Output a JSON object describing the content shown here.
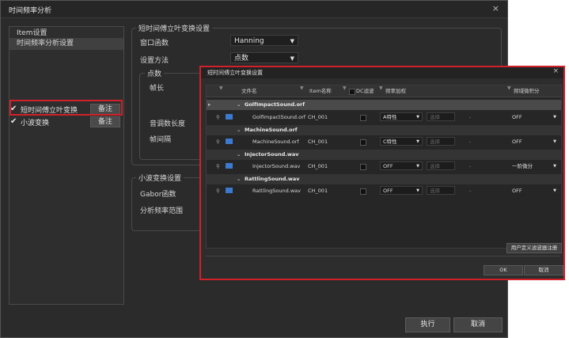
{
  "window": {
    "title": "时间频率分析",
    "close": "×"
  },
  "left": {
    "items": [
      {
        "label": "Item设置"
      },
      {
        "label": "时间频率分析设置"
      }
    ],
    "checks": [
      {
        "label": "短时间傅立叶变换",
        "note": "备注",
        "checked": true
      },
      {
        "label": "小波变换",
        "note": "备注",
        "checked": true
      }
    ]
  },
  "stft": {
    "title": "短时间傅立叶变换设置",
    "window_label": "窗口函数",
    "window_value": "Hanning",
    "method_label": "设置方法",
    "method_value": "点数",
    "points_group": "点数",
    "frame_length": "帧长",
    "fft_length": "音调数长度",
    "frame_interval": "帧间隔"
  },
  "wavelet": {
    "title": "小波变换设置",
    "gabor": "Gabor函数",
    "range": "分析频率范围"
  },
  "buttons": {
    "run": "执行",
    "cancel": "取消"
  },
  "dialog": {
    "title": "短时间傅立叶变换设置",
    "close": "×",
    "headers": [
      "文件名",
      "Item名称",
      "DC滤波",
      "频率加权",
      "频域微积分"
    ],
    "files": [
      {
        "group": "GolfImpactSound.orf",
        "file": "GolfImpactSound.orf",
        "ch": "CH_001",
        "weight": "A特性",
        "extra": "选择",
        "dash": "-",
        "integral": "OFF"
      },
      {
        "group": "MachineSound.orf",
        "file": "MachineSound.orf",
        "ch": "CH_001",
        "weight": "C特性",
        "extra": "选择",
        "dash": "-",
        "integral": "OFF"
      },
      {
        "group": "InjectorSound.wav",
        "file": "InjectorSound.wav",
        "ch": "CH_001",
        "weight": "OFF",
        "extra": "选择",
        "dash": "-",
        "integral": "一阶微分"
      },
      {
        "group": "RattlingSound.wav",
        "file": "RattlingSound.wav",
        "ch": "CH_001",
        "weight": "OFF",
        "extra": "选择",
        "dash": "-",
        "integral": "OFF"
      }
    ],
    "custom_button": "用户定义滤波器注册",
    "ok": "OK",
    "cancel": "取消"
  },
  "colors": {
    "accent_red": "#d0202a",
    "swatch_blue": "#3c7ad0",
    "bg": "#2b2b2b"
  }
}
